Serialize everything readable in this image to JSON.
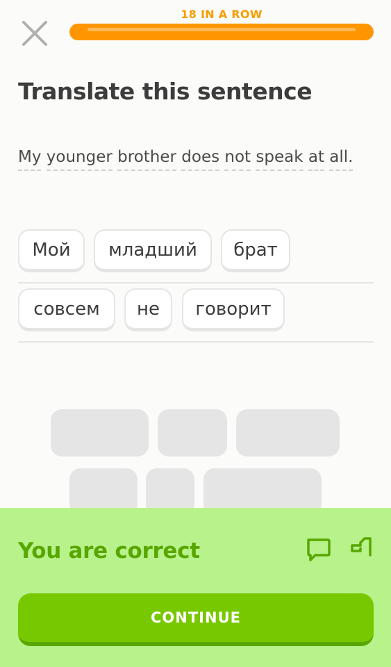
{
  "header": {
    "close_icon": "close-icon",
    "streak_label": "18 IN A ROW",
    "progress_fraction": 1.0,
    "progress_color": "#ff9600"
  },
  "prompt": {
    "title": "Translate this sentence",
    "sentence_words": [
      "My",
      "younger",
      "brother",
      "does",
      "not",
      "speak",
      "at",
      "all."
    ]
  },
  "answer": {
    "words": [
      "Мой",
      "младший",
      "брат",
      "совсем",
      "не",
      "говорит"
    ]
  },
  "feedback": {
    "message": "You are correct",
    "discuss_icon": "comment-icon",
    "report_icon": "flag-icon",
    "continue_label": "CONTINUE",
    "accent_color": "#58a700",
    "panel_color": "#b8f28b"
  }
}
